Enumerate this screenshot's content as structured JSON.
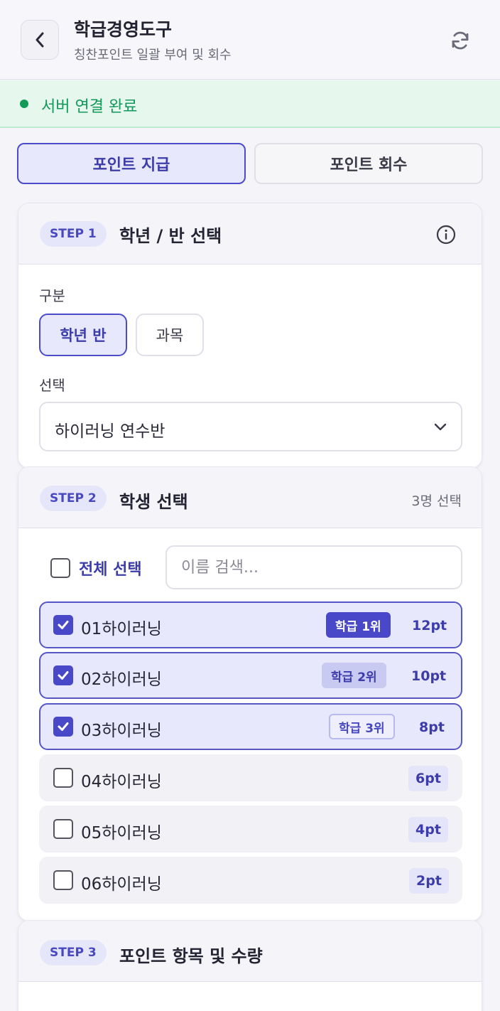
{
  "header": {
    "title": "학급경영도구",
    "subtitle": "칭찬포인트 일괄 부여 및 회수"
  },
  "status": {
    "text": "서버 연결 완료",
    "color": "#119b57"
  },
  "mode_tabs": [
    {
      "label": "포인트 지급",
      "active": true
    },
    {
      "label": "포인트 회수",
      "active": false
    }
  ],
  "step1": {
    "pill": "STEP 1",
    "title": "학년 / 반 선택",
    "category_label": "구분",
    "options": [
      "학년 반",
      "과목"
    ],
    "selected_option": "학년 반",
    "select_label": "선택",
    "select_value": "하이러닝 연수반"
  },
  "step2": {
    "pill": "STEP 2",
    "title": "학생 선택",
    "count_text": "3명 선택",
    "select_all_label": "전체 선택",
    "search_placeholder": "이름 검색...",
    "students": [
      {
        "name": "01하이러닝",
        "checked": true,
        "rank": "학급 1위",
        "points": "12pt"
      },
      {
        "name": "02하이러닝",
        "checked": true,
        "rank": "학급 2위",
        "points": "10pt"
      },
      {
        "name": "03하이러닝",
        "checked": true,
        "rank": "학급 3위",
        "points": "8pt"
      },
      {
        "name": "04하이러닝",
        "checked": false,
        "rank": "",
        "points": "6pt"
      },
      {
        "name": "05하이러닝",
        "checked": false,
        "rank": "",
        "points": "4pt"
      },
      {
        "name": "06하이러닝",
        "checked": false,
        "rank": "",
        "points": "2pt"
      }
    ]
  },
  "step3": {
    "pill": "STEP 3",
    "title": "포인트 항목 및 수량"
  },
  "colors": {
    "accent": "#4848c8",
    "accent_bg": "#e7e8fb",
    "success": "#119b57"
  }
}
